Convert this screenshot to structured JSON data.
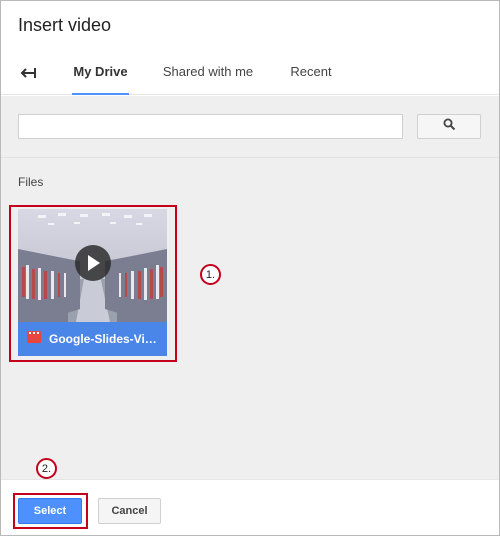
{
  "dialog": {
    "title": "Insert video"
  },
  "nav": {
    "back_icon": "back-arrow-icon",
    "tabs": [
      {
        "label": "My Drive",
        "active": true
      },
      {
        "label": "Shared with me",
        "active": false
      },
      {
        "label": "Recent",
        "active": false
      }
    ]
  },
  "search": {
    "value": "",
    "placeholder": "",
    "button_icon": "search-icon"
  },
  "files": {
    "section_label": "Files",
    "items": [
      {
        "name": "Google-Slides-Vide...",
        "type_icon": "video-file-icon"
      }
    ]
  },
  "annotations": {
    "step1": "1.",
    "step2": "2.",
    "color": "#c4001a"
  },
  "footer": {
    "select_label": "Select",
    "cancel_label": "Cancel"
  },
  "colors": {
    "accent": "#4d90fe",
    "file_footer": "#4a86e8",
    "content_bg": "#efefef"
  }
}
